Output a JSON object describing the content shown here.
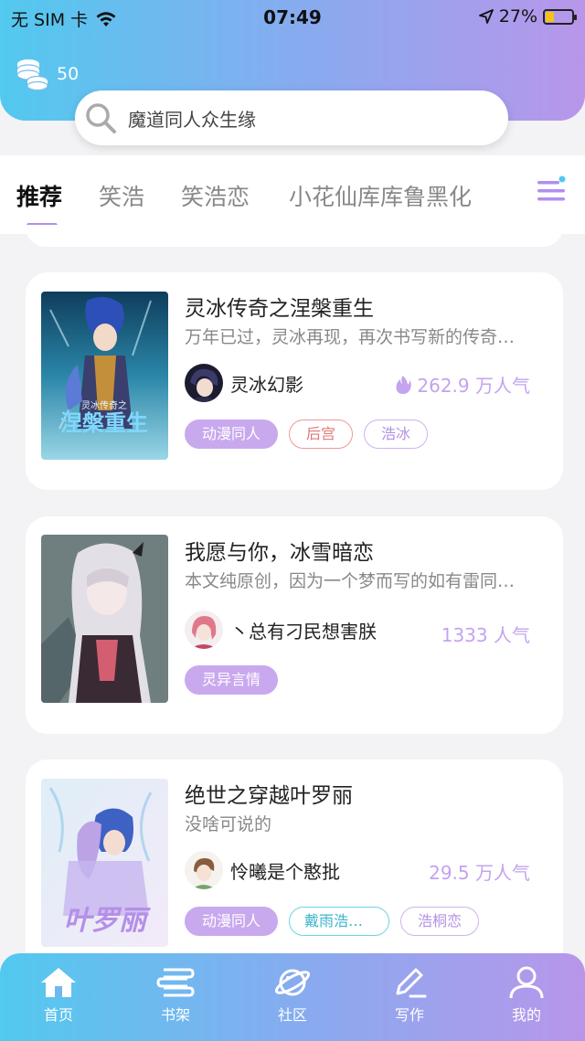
{
  "status_bar": {
    "carrier": "无 SIM 卡",
    "time": "07:49",
    "battery": "27%"
  },
  "header": {
    "coins": "50",
    "search_placeholder": "魔道同人众生缘"
  },
  "tabs": [
    {
      "label": "推荐",
      "active": true
    },
    {
      "label": "笑浩",
      "active": false
    },
    {
      "label": "笑浩恋",
      "active": false
    },
    {
      "label": "小花仙库库鲁黑化",
      "active": false
    }
  ],
  "books": [
    {
      "title": "灵冰传奇之涅槃重生",
      "desc": "万年已过，灵冰再现，再次书写新的传奇…",
      "author": "灵冰幻影",
      "popularity": "262.9 万人气",
      "hot": true,
      "tags": [
        {
          "label": "动漫同人",
          "style": "filled"
        },
        {
          "label": "后宫",
          "style": "red"
        },
        {
          "label": "浩冰",
          "style": "purple"
        }
      ]
    },
    {
      "title": "我愿与你，冰雪暗恋",
      "desc": "本文纯原创，因为一个梦而写的如有雷同…",
      "author": "丶总有刁民想害朕",
      "popularity": "1333 人气",
      "hot": false,
      "tags": [
        {
          "label": "灵异言情",
          "style": "filled"
        }
      ]
    },
    {
      "title": "绝世之穿越叶罗丽",
      "desc": "没啥可说的",
      "author": "怜曦是个憨批",
      "popularity": "29.5 万人气",
      "hot": false,
      "tags": [
        {
          "label": "动漫同人",
          "style": "filled"
        },
        {
          "label": "戴雨浩穿…",
          "style": "cyan"
        },
        {
          "label": "浩桐恋",
          "style": "purple"
        }
      ]
    }
  ],
  "bottom_nav": [
    {
      "label": "首页",
      "icon": "home-icon",
      "active": true
    },
    {
      "label": "书架",
      "icon": "bookshelf-icon",
      "active": false
    },
    {
      "label": "社区",
      "icon": "planet-icon",
      "active": false
    },
    {
      "label": "写作",
      "icon": "pen-icon",
      "active": false
    },
    {
      "label": "我的",
      "icon": "user-icon",
      "active": false
    }
  ],
  "colors": {
    "gradient_start": "#52c9ef",
    "gradient_end": "#b896ea",
    "accent": "#b18ef0",
    "popularity": "#c4a3ef"
  }
}
